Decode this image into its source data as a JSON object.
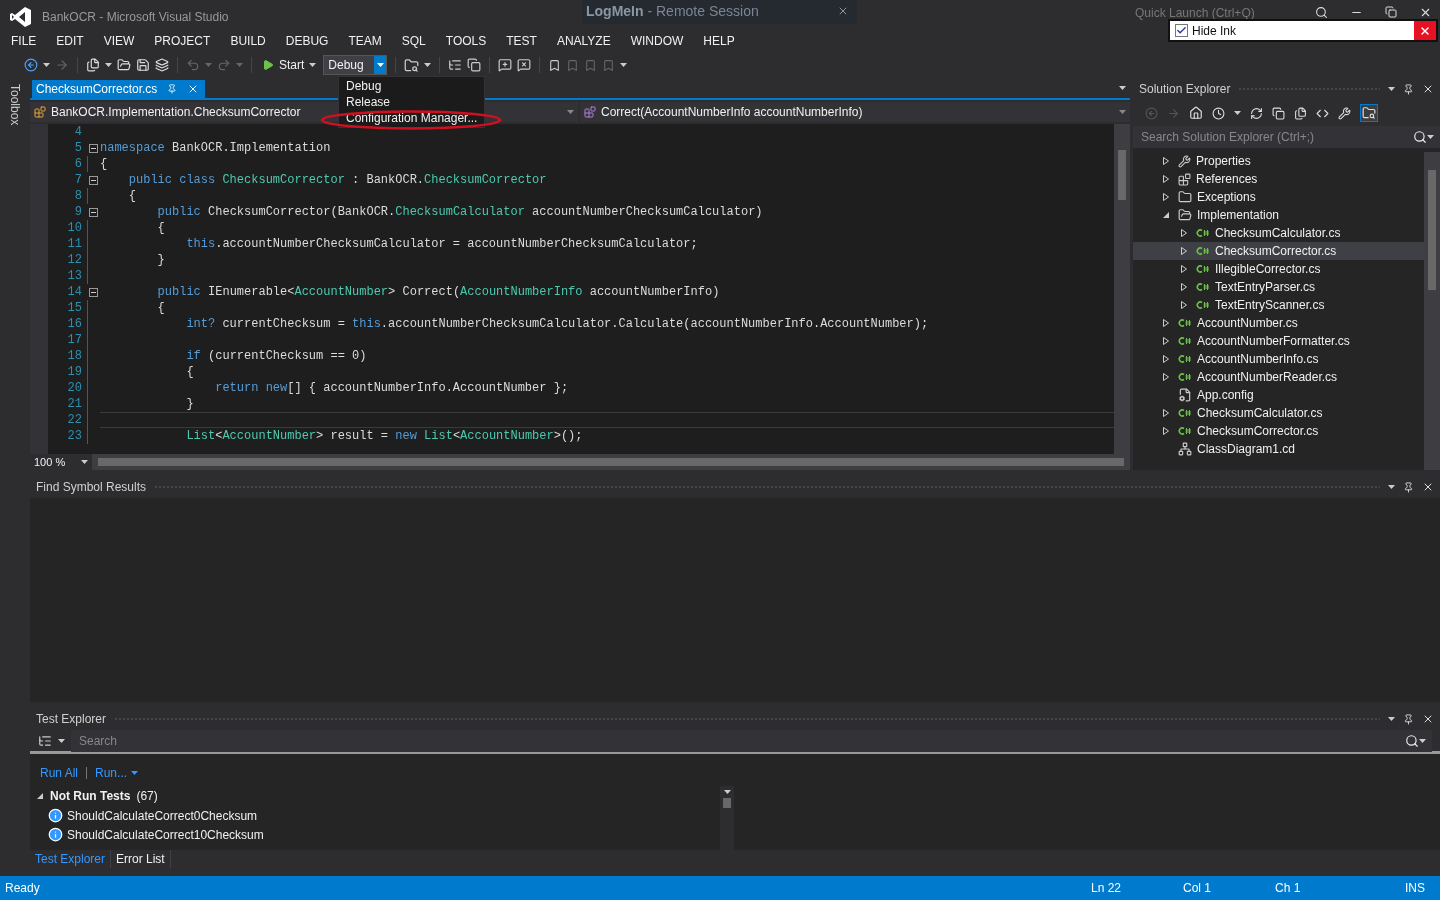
{
  "window": {
    "title": "BankOCR - Microsoft Visual Studio",
    "quick_launch": {
      "placeholder": "Quick Launch (Ctrl+Q)"
    }
  },
  "remote_session": {
    "brand": "LogMeIn",
    "label": "-  Remote Session"
  },
  "ink_toolbar": {
    "label": "Hide Ink",
    "checked": true
  },
  "menu": [
    "FILE",
    "EDIT",
    "VIEW",
    "PROJECT",
    "BUILD",
    "DEBUG",
    "TEAM",
    "SQL",
    "TOOLS",
    "TEST",
    "ANALYZE",
    "WINDOW",
    "HELP"
  ],
  "toolbar": {
    "start": "Start",
    "configuration": "Debug",
    "dropdown": [
      "Debug",
      "Release",
      "Configuration Manager..."
    ]
  },
  "toolbox": {
    "label": "Toolbox"
  },
  "editor": {
    "tabs": [
      {
        "label": "ChecksumCorrector.cs",
        "selected": true
      }
    ],
    "type_scope": "BankOCR.Implementation.ChecksumCorrector",
    "member_scope": "Correct(AccountNumberInfo accountNumberInfo)",
    "lines": [
      {
        "number": "4",
        "fold": false,
        "current": false
      },
      {
        "number": "5",
        "fold": true,
        "current": false,
        "tokens": [
          {
            "kind": "keyword",
            "text": "namespace"
          },
          {
            "kind": "plain",
            "text": " BankOCR.Implementation"
          }
        ]
      },
      {
        "number": "6",
        "fold": false,
        "current": false,
        "tokens": [
          {
            "kind": "plain",
            "text": "{"
          }
        ]
      },
      {
        "number": "7",
        "fold": true,
        "current": false,
        "tokens": [
          {
            "kind": "keyword",
            "text": "    public class "
          },
          {
            "kind": "type",
            "text": "ChecksumCorrector"
          },
          {
            "kind": "plain",
            "text": " : BankOCR."
          },
          {
            "kind": "type",
            "text": "ChecksumCorrector"
          }
        ]
      },
      {
        "number": "8",
        "fold": false,
        "current": false,
        "tokens": [
          {
            "kind": "plain",
            "text": "    {"
          }
        ]
      },
      {
        "number": "9",
        "fold": true,
        "current": false,
        "tokens": [
          {
            "kind": "keyword",
            "text": "        public"
          },
          {
            "kind": "plain",
            "text": " ChecksumCorrector(BankOCR."
          },
          {
            "kind": "type",
            "text": "ChecksumCalculator"
          },
          {
            "kind": "plain",
            "text": " accountNumberChecksumCalculator)"
          }
        ]
      },
      {
        "number": "10",
        "fold": false,
        "current": false,
        "tokens": [
          {
            "kind": "plain",
            "text": "        {"
          }
        ]
      },
      {
        "number": "11",
        "fold": false,
        "current": false,
        "tokens": [
          {
            "kind": "keyword",
            "text": "            this"
          },
          {
            "kind": "plain",
            "text": ".accountNumberChecksumCalculator = accountNumberChecksumCalculator;"
          }
        ]
      },
      {
        "number": "12",
        "fold": false,
        "current": false,
        "tokens": [
          {
            "kind": "plain",
            "text": "        }"
          }
        ]
      },
      {
        "number": "13",
        "fold": false,
        "current": false
      },
      {
        "number": "14",
        "fold": true,
        "current": false,
        "tokens": [
          {
            "kind": "keyword",
            "text": "        public"
          },
          {
            "kind": "plain",
            "text": " IEnumerable<"
          },
          {
            "kind": "type",
            "text": "AccountNumber"
          },
          {
            "kind": "plain",
            "text": "> Correct("
          },
          {
            "kind": "type",
            "text": "AccountNumberInfo"
          },
          {
            "kind": "plain",
            "text": " accountNumberInfo)"
          }
        ]
      },
      {
        "number": "15",
        "fold": false,
        "current": false,
        "tokens": [
          {
            "kind": "plain",
            "text": "        {"
          }
        ]
      },
      {
        "number": "16",
        "fold": false,
        "current": false,
        "tokens": [
          {
            "kind": "keyword",
            "text": "            int?"
          },
          {
            "kind": "plain",
            "text": " currentChecksum = "
          },
          {
            "kind": "keyword",
            "text": "this"
          },
          {
            "kind": "plain",
            "text": ".accountNumberChecksumCalculator.Calculate(accountNumberInfo.AccountNumber);"
          }
        ]
      },
      {
        "number": "17",
        "fold": false,
        "current": false
      },
      {
        "number": "18",
        "fold": false,
        "current": false,
        "tokens": [
          {
            "kind": "keyword",
            "text": "            if"
          },
          {
            "kind": "plain",
            "text": " (currentChecksum == 0)"
          }
        ]
      },
      {
        "number": "19",
        "fold": false,
        "current": false,
        "tokens": [
          {
            "kind": "plain",
            "text": "            {"
          }
        ]
      },
      {
        "number": "20",
        "fold": false,
        "current": false,
        "tokens": [
          {
            "kind": "keyword",
            "text": "                return new"
          },
          {
            "kind": "plain",
            "text": "[] { accountNumberInfo.AccountNumber };"
          }
        ]
      },
      {
        "number": "21",
        "fold": false,
        "current": false,
        "tokens": [
          {
            "kind": "plain",
            "text": "            }"
          }
        ]
      },
      {
        "number": "22",
        "fold": false,
        "current": true
      },
      {
        "number": "23",
        "fold": false,
        "current": false,
        "tokens": [
          {
            "kind": "type",
            "text": "            List"
          },
          {
            "kind": "plain",
            "text": "<"
          },
          {
            "kind": "type",
            "text": "AccountNumber"
          },
          {
            "kind": "plain",
            "text": "> result = "
          },
          {
            "kind": "keyword",
            "text": "new "
          },
          {
            "kind": "type",
            "text": "List"
          },
          {
            "kind": "plain",
            "text": "<"
          },
          {
            "kind": "type",
            "text": "AccountNumber"
          },
          {
            "kind": "plain",
            "text": ">();"
          }
        ]
      }
    ],
    "zoom": "100 %"
  },
  "solution_explorer": {
    "title": "Solution Explorer",
    "search": {
      "placeholder": "Search Solution Explorer (Ctrl+;)"
    },
    "tree": [
      {
        "label": "Properties",
        "kind": "properties",
        "expanded": false,
        "selected": false
      },
      {
        "label": "References",
        "kind": "references",
        "expanded": false,
        "selected": false
      },
      {
        "label": "Exceptions",
        "kind": "folder",
        "expanded": false,
        "selected": false
      },
      {
        "label": "Implementation",
        "kind": "folder",
        "expanded": true,
        "selected": false,
        "children": [
          {
            "label": "ChecksumCalculator.cs",
            "kind": "csharp",
            "expanded": false,
            "selected": false
          },
          {
            "label": "ChecksumCorrector.cs",
            "kind": "csharp",
            "expanded": false,
            "selected": true
          },
          {
            "label": "IllegibleCorrector.cs",
            "kind": "csharp",
            "expanded": false,
            "selected": false
          },
          {
            "label": "TextEntryParser.cs",
            "kind": "csharp",
            "expanded": false,
            "selected": false
          },
          {
            "label": "TextEntryScanner.cs",
            "kind": "csharp",
            "expanded": false,
            "selected": false
          }
        ]
      },
      {
        "label": "AccountNumber.cs",
        "kind": "csharp",
        "expanded": false,
        "selected": false
      },
      {
        "label": "AccountNumberFormatter.cs",
        "kind": "csharp",
        "expanded": false,
        "selected": false
      },
      {
        "label": "AccountNumberInfo.cs",
        "kind": "csharp",
        "expanded": false,
        "selected": false
      },
      {
        "label": "AccountNumberReader.cs",
        "kind": "csharp",
        "expanded": false,
        "selected": false
      },
      {
        "label": "App.config",
        "kind": "config",
        "selected": false
      },
      {
        "label": "ChecksumCalculator.cs",
        "kind": "csharp",
        "expanded": false,
        "selected": false
      },
      {
        "label": "ChecksumCorrector.cs",
        "kind": "csharp",
        "expanded": false,
        "selected": false
      },
      {
        "label": "ClassDiagram1.cd",
        "kind": "diagram",
        "selected": false
      }
    ]
  },
  "find_symbol_results": {
    "title": "Find Symbol Results"
  },
  "test_explorer": {
    "title": "Test Explorer",
    "search": {
      "placeholder": "Search"
    },
    "actions": [
      "Run All",
      "Run..."
    ],
    "groups": [
      {
        "label": "Not Run Tests",
        "count": "(67)",
        "expanded": true,
        "tests": [
          {
            "name": "ShouldCalculateCorrect0Checksum"
          },
          {
            "name": "ShouldCalculateCorrect10Checksum"
          }
        ]
      }
    ]
  },
  "bottom_tabs": [
    {
      "label": "Test Explorer",
      "selected": true
    },
    {
      "label": "Error List",
      "selected": false
    }
  ],
  "status_bar": {
    "message": "Ready",
    "line": "Ln 22",
    "column": "Col 1",
    "char": "Ch 1",
    "mode": "INS"
  }
}
